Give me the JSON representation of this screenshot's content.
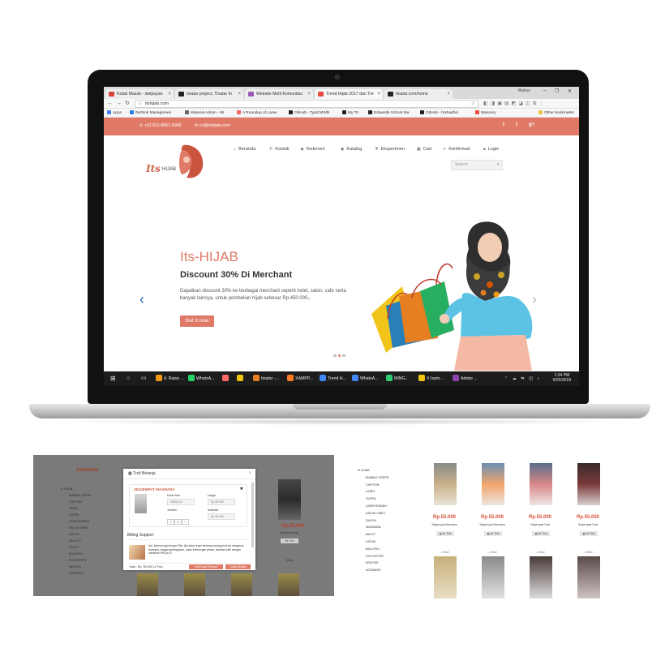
{
  "browser": {
    "tabs": [
      {
        "label": "Kotak Masuk - dwipayan",
        "color": "#d44638"
      },
      {
        "label": "tinatar project, Tinatar In",
        "color": "#222222"
      },
      {
        "label": "Website Multi Komunitas",
        "color": "#9b59b6"
      },
      {
        "label": "Trend Hijab 2017 dan Tre",
        "color": "#e74c3c"
      },
      {
        "label": "tinatar.com/home",
        "color": "#222222"
      }
    ],
    "user": "Wahyu",
    "url": "itshijab.com",
    "bookmarks": [
      {
        "label": "Apps",
        "color": "#4285f4"
      },
      {
        "label": "Rethink Managemen",
        "color": "#2c7be5"
      },
      {
        "label": "Material Admin - Mi",
        "color": "#666666"
      },
      {
        "label": "A Roundup of Larav",
        "color": "#f4645f"
      },
      {
        "label": "GitHub - TypiCMS/B",
        "color": "#222222"
      },
      {
        "label": "My Tri",
        "color": "#222222"
      },
      {
        "label": "Eduwella School Ma",
        "color": "#222222"
      },
      {
        "label": "GitHub - hrshadhin",
        "color": "#222222"
      },
      {
        "label": "Masonry",
        "color": "#e74c3c"
      },
      {
        "label": "Other bookmarks",
        "color": "#f0c040"
      }
    ]
  },
  "site": {
    "phone": "+62 812-8861-6068",
    "email": "cs@itshijab.com",
    "social": [
      "f",
      "t",
      "g+"
    ],
    "logo_its": "Its",
    "logo_hijab": "HIJAB",
    "menu": [
      "Beranda",
      "Kontak",
      "Testimoni",
      "Katalog",
      "Eksperimen",
      "Cart",
      "Konfirmasi",
      "Login"
    ],
    "search_placeholder": "Search",
    "hero": {
      "title_a": "Its",
      "title_b": "-HIJAB",
      "subtitle": "Discount 30% Di Merchant",
      "description": "Dapatkan discount 30% ke berbagai merchant seperti hotel, salon, cafe serta banyak lainnya, untuk pembelian hijab sebesar Rp.450.000,-",
      "button": "Get it now",
      "active_slide": 1
    }
  },
  "taskbar": {
    "items": [
      {
        "label": "4. Raisa ...",
        "color": "#f39c12"
      },
      {
        "label": "WhatsA...",
        "color": "#25d366"
      },
      {
        "label": "",
        "color": "#ff6b6b"
      },
      {
        "label": "",
        "color": "#f1c40f"
      },
      {
        "label": "tinatar -...",
        "color": "#e67e22"
      },
      {
        "label": "XAMPP...",
        "color": "#fb7a24"
      },
      {
        "label": "Trend H...",
        "color": "#4285f4"
      },
      {
        "label": "WhatsA...",
        "color": "#4285f4"
      },
      {
        "label": "MING...",
        "color": "#2ecc71"
      },
      {
        "label": "X:\\xam...",
        "color": "#f1c40f"
      },
      {
        "label": "Adobe ...",
        "color": "#8e44ad"
      }
    ],
    "time": "1:34 PM",
    "date": "5/25/2018"
  },
  "shot_cart": {
    "category_title": "KATEGORI",
    "categories": [
      "HIJAB",
      "BUBBLE CREPE",
      "CHIFFON",
      "LINEN",
      "SUTRA",
      "LINEN RUBIAH",
      "KATUN VINEY",
      "RAYON",
      "BALLOTI",
      "KATUN",
      "BALUTELI",
      "POLYESTER",
      "WOLFEE",
      "ACEWASH"
    ],
    "modal_title": "Troli Belanja",
    "item_name": "SEGIEMPAT MAXMARA",
    "lbl_code": "Kode Item",
    "code": "NPAG/LS",
    "lbl_price": "Harga",
    "price": "Rp 50.000",
    "lbl_qty": "Jumlah",
    "qty": "1",
    "lbl_subtotal": "Subtotal",
    "subtotal": "Rp 50.000",
    "billing_title": "Billing Support",
    "billing_text": "Hai, ketemu lagi dengan Pita, jika kamu ingin bertanya tentang hal hal mengenai transaksi, tinggal pembayaran, untuk keterangan pesan, silahkan pilih dengan menekan Pita ya :D",
    "total": "Total : Rp. 55.000 (1 Pcs)",
    "btn_confirm": "Konfirmasi Pesanan",
    "btn_continue": "Lanjut Belanja",
    "bg_price": "Rp.55.000",
    "bg_name": "Segiempat Voal",
    "bg_btn": "Ke Troli",
    "bg_detail": "Detail"
  },
  "shot_catalog": {
    "categories": [
      "HIJAB",
      "BUBBLE CREPE",
      "CHIFFON",
      "LINEN",
      "SUTRA",
      "LINEN RUBIAH",
      "KATUN VINEY",
      "RAYON",
      "MAXMARA",
      "BALOT",
      "KATUN",
      "BALUTELI",
      "POLYESTER",
      "WOLFEE",
      "ACEWASH"
    ],
    "products": [
      {
        "price": "Rp.55.000",
        "name": "Segiempat Maxmara",
        "button": "Ke Troli",
        "detail": "Detail",
        "color": "#c9b18a"
      },
      {
        "price": "Rp.55.000",
        "name": "Segiempat Maxmara",
        "button": "Ke Troli",
        "detail": "Detail",
        "color": "#f2a46b"
      },
      {
        "price": "Rp.55.000",
        "name": "Segiempat Voal",
        "button": "Ke Troli",
        "detail": "Detail",
        "color": "#d98686"
      },
      {
        "price": "Rp.55.000",
        "name": "Segiempat Voal",
        "button": "Ke Troli",
        "detail": "Detail",
        "color": "#7a3a3a"
      }
    ]
  }
}
